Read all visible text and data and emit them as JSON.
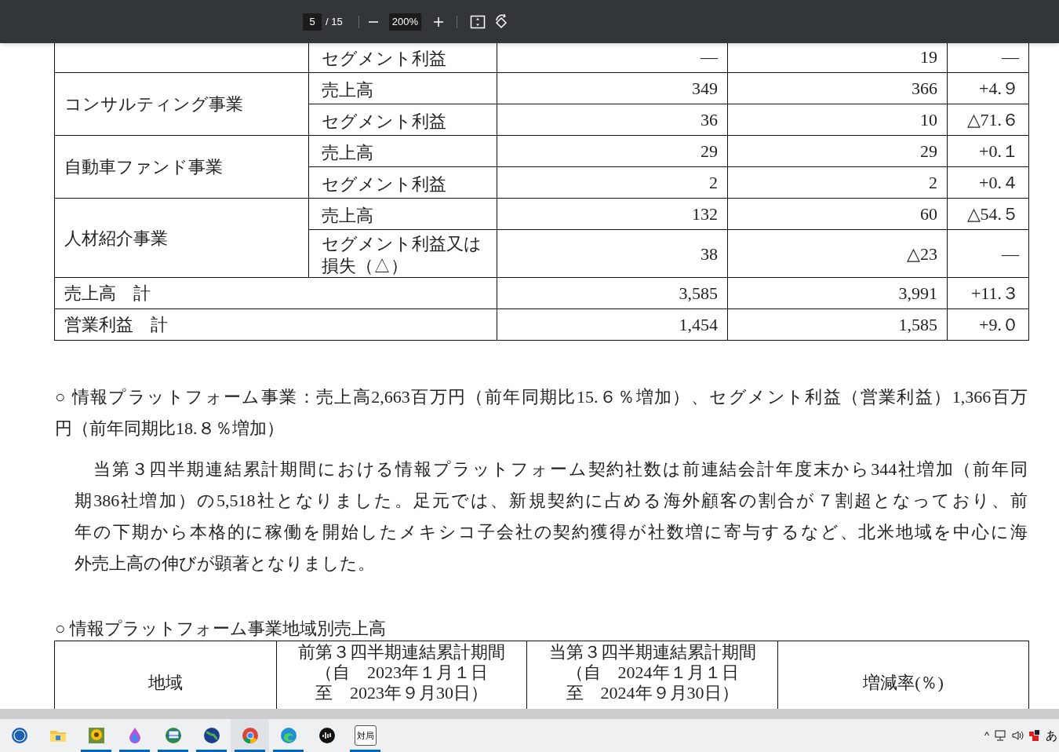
{
  "toolbar": {
    "page": "5",
    "page_count": "/ 15",
    "zoom": "200%"
  },
  "segment_table": {
    "groups": [
      {
        "items": [
          {
            "metric": "セグメント利益",
            "prev": "—",
            "curr": "19",
            "change": "—"
          }
        ]
      },
      {
        "name": "コンサルティング事業",
        "items": [
          {
            "metric": "売上高",
            "prev": "349",
            "curr": "366",
            "change": "+4.９"
          },
          {
            "metric": "セグメント利益",
            "prev": "36",
            "curr": "10",
            "change": "△71.６"
          }
        ]
      },
      {
        "name": "自動車ファンド事業",
        "items": [
          {
            "metric": "売上高",
            "prev": "29",
            "curr": "29",
            "change": "+0.１"
          },
          {
            "metric": "セグメント利益",
            "prev": "2",
            "curr": "2",
            "change": "+0.４"
          }
        ]
      },
      {
        "name": "人材紹介事業",
        "items": [
          {
            "metric": "売上高",
            "prev": "132",
            "curr": "60",
            "change": "△54.５"
          },
          {
            "metric": "セグメント利益又は損失（△）",
            "prev": "38",
            "curr": "△23",
            "change": "—"
          }
        ]
      }
    ],
    "totals": [
      {
        "label": "売上高　計",
        "prev": "3,585",
        "curr": "3,991",
        "change": "+11.３"
      },
      {
        "label": "営業利益　計",
        "prev": "1,454",
        "curr": "1,585",
        "change": "+9.０"
      }
    ]
  },
  "paragraphs": [
    {
      "kind": "bullet",
      "lines": [
        "○ 情報プラットフォーム事業：売上高2,663百万円（前年同期比15.６％増加）、セグメント利益（営業利益）1,366百万",
        "円（前年同期比18.８％増加）"
      ]
    },
    {
      "kind": "body",
      "lines": [
        "当第３四半期連結累計期間における情報プラットフォーム契約社数は前連結会計年度末から344社増加（前年同",
        "期386社増加）の5,518社となりました。足元では、新規契約に占める海外顧客の割合が７割超となっており、前",
        "年の下期から本格的に稼働を開始したメキシコ子会社の契約獲得が社数増に寄与するなど、北米地域を中心に海",
        "外売上高の伸びが顕著となりました。"
      ]
    }
  ],
  "region_heading": "○ 情報プラットフォーム事業地域別売上高",
  "region_table": {
    "columns": [
      {
        "lines": [
          "地域"
        ]
      },
      {
        "lines": [
          "前第３四半期連結累計期間",
          "（自　2023年１月１日",
          "至　2023年９月30日）"
        ]
      },
      {
        "lines": [
          "当第３四半期連結累計期間",
          "（自　2024年１月１日",
          "至　2024年９月30日）"
        ]
      },
      {
        "lines": [
          "増減率(％)"
        ]
      }
    ]
  },
  "taskbar": {
    "apps": [
      {
        "running": false,
        "selected": false
      },
      {
        "running": false,
        "selected": false
      },
      {
        "running": true,
        "selected": false
      },
      {
        "running": true,
        "selected": false
      },
      {
        "running": true,
        "selected": false
      },
      {
        "running": true,
        "selected": false
      },
      {
        "running": true,
        "selected": true
      },
      {
        "running": true,
        "selected": false
      },
      {
        "running": false,
        "selected": false
      },
      {
        "label": "対局",
        "running": true,
        "selected": false
      }
    ],
    "tray": {
      "caret": "^",
      "ime": "あ"
    }
  }
}
